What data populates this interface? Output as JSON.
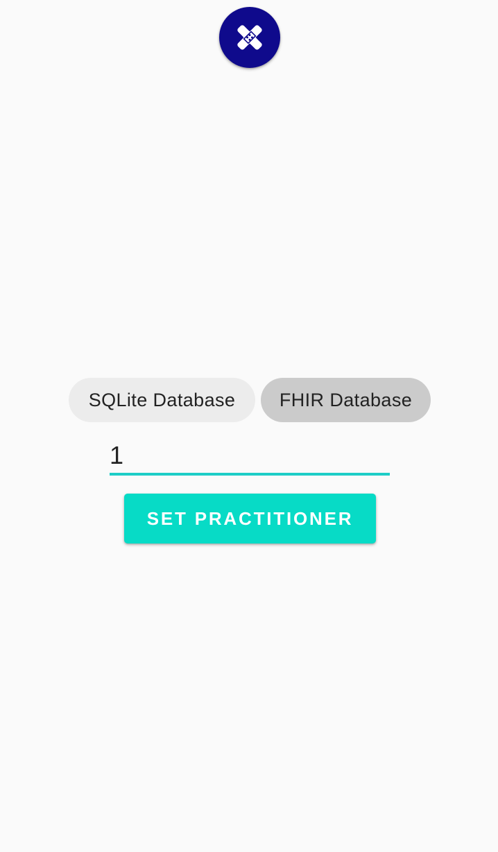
{
  "fab": {
    "icon": "bandage-icon",
    "background_color": "#0f0a8c"
  },
  "database_chips": [
    {
      "label": "SQLite Database",
      "selected": false
    },
    {
      "label": "FHIR Database",
      "selected": true
    }
  ],
  "practitioner_input": {
    "value": "1",
    "underline_color": "#1dcdc7"
  },
  "set_practitioner_button": {
    "label": "SET PRACTITIONER",
    "color": "#07dbc6"
  }
}
